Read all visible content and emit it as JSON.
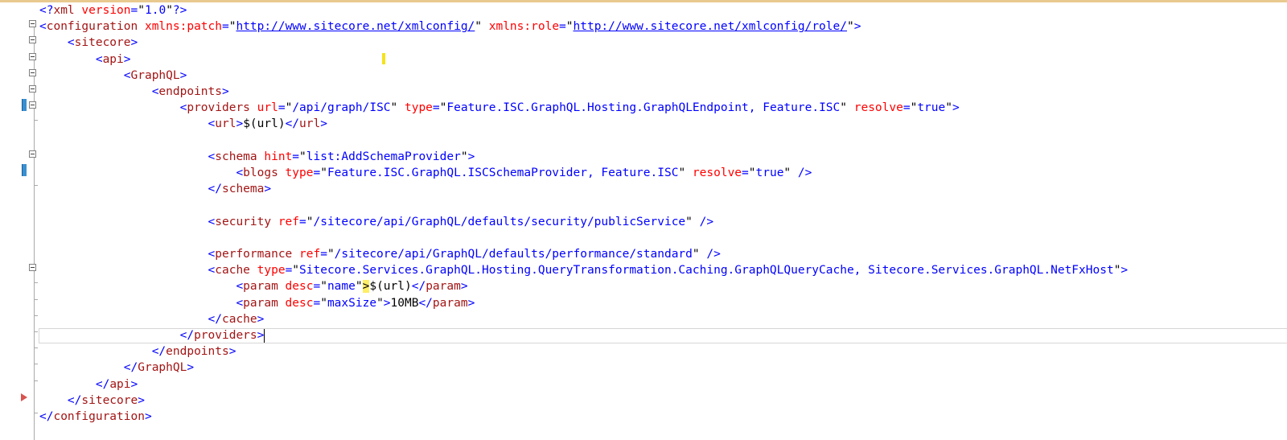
{
  "editor": {
    "current_line": 20,
    "lines": [
      [
        [
          "d",
          "<?"
        ],
        [
          "t",
          "xml"
        ],
        [
          "a",
          " version"
        ],
        [
          "d",
          "="
        ],
        [
          "x",
          "\""
        ],
        [
          "v",
          "1.0"
        ],
        [
          "x",
          "\""
        ],
        [
          "d",
          "?>"
        ]
      ],
      [
        [
          "d",
          "<"
        ],
        [
          "t",
          "configuration"
        ],
        [
          "a",
          " xmlns:patch"
        ],
        [
          "d",
          "="
        ],
        [
          "x",
          "\""
        ],
        [
          "u",
          "http://www.sitecore.net/xmlconfig/"
        ],
        [
          "x",
          "\""
        ],
        [
          "a",
          " xmlns:role"
        ],
        [
          "d",
          "="
        ],
        [
          "x",
          "\""
        ],
        [
          "u",
          "http://www.sitecore.net/xmlconfig/role/"
        ],
        [
          "x",
          "\""
        ],
        [
          "d",
          ">"
        ]
      ],
      [
        [
          "i",
          "    "
        ],
        [
          "d",
          "<"
        ],
        [
          "t",
          "sitecore"
        ],
        [
          "d",
          ">"
        ]
      ],
      [
        [
          "i",
          "        "
        ],
        [
          "d",
          "<"
        ],
        [
          "t",
          "api"
        ],
        [
          "d",
          ">"
        ]
      ],
      [
        [
          "i",
          "            "
        ],
        [
          "d",
          "<"
        ],
        [
          "t",
          "GraphQL"
        ],
        [
          "d",
          ">"
        ]
      ],
      [
        [
          "i",
          "                "
        ],
        [
          "d",
          "<"
        ],
        [
          "t",
          "endpoints"
        ],
        [
          "d",
          ">"
        ]
      ],
      [
        [
          "i",
          "                    "
        ],
        [
          "d",
          "<"
        ],
        [
          "t",
          "providers"
        ],
        [
          "a",
          " url"
        ],
        [
          "d",
          "="
        ],
        [
          "x",
          "\""
        ],
        [
          "v",
          "/api/graph/ISC"
        ],
        [
          "x",
          "\""
        ],
        [
          "a",
          " type"
        ],
        [
          "d",
          "="
        ],
        [
          "x",
          "\""
        ],
        [
          "v",
          "Feature.ISC.GraphQL.Hosting.GraphQLEndpoint, Feature.ISC"
        ],
        [
          "x",
          "\""
        ],
        [
          "a",
          " resolve"
        ],
        [
          "d",
          "="
        ],
        [
          "x",
          "\""
        ],
        [
          "v",
          "true"
        ],
        [
          "x",
          "\""
        ],
        [
          "d",
          ">"
        ]
      ],
      [
        [
          "i",
          "                        "
        ],
        [
          "d",
          "<"
        ],
        [
          "t",
          "url"
        ],
        [
          "d",
          ">"
        ],
        [
          "x",
          "$(url)"
        ],
        [
          "d",
          "</"
        ],
        [
          "t",
          "url"
        ],
        [
          "d",
          ">"
        ]
      ],
      [],
      [
        [
          "i",
          "                        "
        ],
        [
          "d",
          "<"
        ],
        [
          "t",
          "schema"
        ],
        [
          "a",
          " hint"
        ],
        [
          "d",
          "="
        ],
        [
          "x",
          "\""
        ],
        [
          "v",
          "list:AddSchemaProvider"
        ],
        [
          "x",
          "\""
        ],
        [
          "d",
          ">"
        ]
      ],
      [
        [
          "i",
          "                            "
        ],
        [
          "d",
          "<"
        ],
        [
          "t",
          "blogs"
        ],
        [
          "a",
          " type"
        ],
        [
          "d",
          "="
        ],
        [
          "x",
          "\""
        ],
        [
          "v",
          "Feature.ISC.GraphQL.ISCSchemaProvider, Feature.ISC"
        ],
        [
          "x",
          "\""
        ],
        [
          "a",
          " resolve"
        ],
        [
          "d",
          "="
        ],
        [
          "x",
          "\""
        ],
        [
          "v",
          "true"
        ],
        [
          "x",
          "\""
        ],
        [
          "d",
          " />"
        ]
      ],
      [
        [
          "i",
          "                        "
        ],
        [
          "d",
          "</"
        ],
        [
          "t",
          "schema"
        ],
        [
          "d",
          ">"
        ]
      ],
      [],
      [
        [
          "i",
          "                        "
        ],
        [
          "d",
          "<"
        ],
        [
          "t",
          "security"
        ],
        [
          "a",
          " ref"
        ],
        [
          "d",
          "="
        ],
        [
          "x",
          "\""
        ],
        [
          "v",
          "/sitecore/api/GraphQL/defaults/security/publicService"
        ],
        [
          "x",
          "\""
        ],
        [
          "d",
          " />"
        ]
      ],
      [],
      [
        [
          "i",
          "                        "
        ],
        [
          "d",
          "<"
        ],
        [
          "t",
          "performance"
        ],
        [
          "a",
          " ref"
        ],
        [
          "d",
          "="
        ],
        [
          "x",
          "\""
        ],
        [
          "v",
          "/sitecore/api/GraphQL/defaults/performance/standard"
        ],
        [
          "x",
          "\""
        ],
        [
          "d",
          " />"
        ]
      ],
      [
        [
          "i",
          "                        "
        ],
        [
          "d",
          "<"
        ],
        [
          "t",
          "cache"
        ],
        [
          "a",
          " type"
        ],
        [
          "d",
          "="
        ],
        [
          "x",
          "\""
        ],
        [
          "v",
          "Sitecore.Services.GraphQL.Hosting.QueryTransformation.Caching.GraphQLQueryCache, Sitecore.Services.GraphQL.NetFxHost"
        ],
        [
          "x",
          "\""
        ],
        [
          "d",
          ">"
        ]
      ],
      [
        [
          "i",
          "                            "
        ],
        [
          "d",
          "<"
        ],
        [
          "t",
          "param"
        ],
        [
          "a",
          " desc"
        ],
        [
          "d",
          "="
        ],
        [
          "x",
          "\""
        ],
        [
          "v",
          "name"
        ],
        [
          "x",
          "\""
        ],
        [
          "hl",
          ">"
        ],
        [
          "x",
          "$(url)"
        ],
        [
          "d",
          "</"
        ],
        [
          "t",
          "param"
        ],
        [
          "d",
          ">"
        ]
      ],
      [
        [
          "i",
          "                            "
        ],
        [
          "d",
          "<"
        ],
        [
          "t",
          "param"
        ],
        [
          "a",
          " desc"
        ],
        [
          "d",
          "="
        ],
        [
          "x",
          "\""
        ],
        [
          "v",
          "maxSize"
        ],
        [
          "x",
          "\""
        ],
        [
          "d",
          ">"
        ],
        [
          "x",
          "10MB"
        ],
        [
          "d",
          "</"
        ],
        [
          "t",
          "param"
        ],
        [
          "d",
          ">"
        ]
      ],
      [
        [
          "i",
          "                        "
        ],
        [
          "d",
          "</"
        ],
        [
          "t",
          "cache"
        ],
        [
          "d",
          ">"
        ]
      ],
      [
        [
          "i",
          "                    "
        ],
        [
          "d",
          "</"
        ],
        [
          "t",
          "providers"
        ],
        [
          "d",
          ">"
        ]
      ],
      [
        [
          "i",
          "                "
        ],
        [
          "d",
          "</"
        ],
        [
          "t",
          "endpoints"
        ],
        [
          "d",
          ">"
        ]
      ],
      [
        [
          "i",
          "            "
        ],
        [
          "d",
          "</"
        ],
        [
          "t",
          "GraphQL"
        ],
        [
          "d",
          ">"
        ]
      ],
      [
        [
          "i",
          "        "
        ],
        [
          "d",
          "</"
        ],
        [
          "t",
          "api"
        ],
        [
          "d",
          ">"
        ]
      ],
      [
        [
          "i",
          "    "
        ],
        [
          "d",
          "</"
        ],
        [
          "t",
          "sitecore"
        ],
        [
          "d",
          ">"
        ]
      ],
      [
        [
          "d",
          "</"
        ],
        [
          "t",
          "configuration"
        ],
        [
          "d",
          ">"
        ]
      ]
    ]
  },
  "gutter": {
    "fold_lines": [
      1,
      2,
      3,
      4,
      5,
      6,
      9,
      16
    ],
    "modified_lines": [
      6,
      10
    ],
    "arrow_line": 24
  }
}
